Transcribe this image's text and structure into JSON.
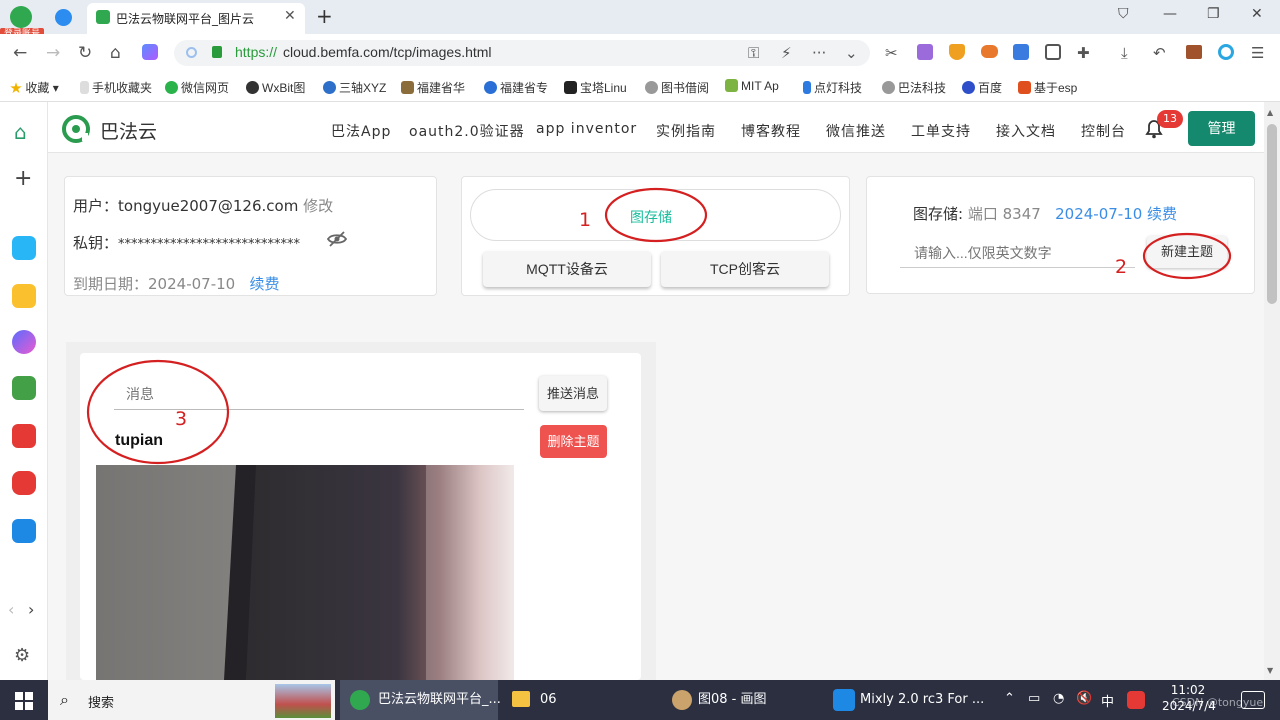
{
  "browser": {
    "login_badge": "登录账号",
    "tab_title": "巴法云物联网平台_图片云",
    "url_protocol": "https://",
    "url_rest": "cloud.bemfa.com/tcp/images.html",
    "bookmarks": [
      "收藏",
      "手机收藏夹",
      "微信网页",
      "WxBit图",
      "三轴XYZ",
      "福建省华",
      "福建省专",
      "宝塔Linu",
      "图书借阅",
      "MIT Ap",
      "点灯科技",
      "巴法科技",
      "百度",
      "基于esp"
    ]
  },
  "site": {
    "logo_text": "巴法云",
    "nav": [
      "巴法App",
      "oauth2.0验证器",
      "app inventor",
      "实例指南",
      "博客教程",
      "微信推送",
      "工单支持",
      "接入文档",
      "控制台"
    ],
    "notification_count": "13",
    "manage_label": "管理"
  },
  "account": {
    "user_label": "用户：",
    "email": "tongyue2007@126.com",
    "edit_label": "修改",
    "key_label": "私钥：",
    "key_masked": "****************************",
    "expire_label": "到期日期：",
    "expire_date": "2024-07-10",
    "renew_label": "续费"
  },
  "cloud_switch": {
    "image_storage": "图存储",
    "mqtt": "MQTT设备云",
    "tcp": "TCP创客云"
  },
  "storage": {
    "title": "图存储:",
    "port": "端口 8347",
    "renew_text": "2024-07-10 续费",
    "topic_placeholder": "请输入...仅限英文数字",
    "new_topic_label": "新建主题"
  },
  "topic_panel": {
    "message_placeholder": "消息",
    "send_label": "推送消息",
    "topic_name": "tupian",
    "delete_label": "删除主题"
  },
  "annotations": [
    "1",
    "2",
    "3"
  ],
  "taskbar": {
    "search_label": "搜索",
    "tasks": [
      "巴法云物联网平台_...",
      "06",
      "图08 - 画图",
      "Mixly 2.0 rc3 For ..."
    ],
    "ime": "中",
    "time": "11:02",
    "date": "2024/7/4"
  },
  "watermark": "CSDN @tongyue",
  "colors": {
    "brand_green": "#14896d",
    "accent_teal": "#1abc9c",
    "danger": "#ef5350",
    "annotation_red": "#d42020",
    "link": "#3a8ee6"
  }
}
